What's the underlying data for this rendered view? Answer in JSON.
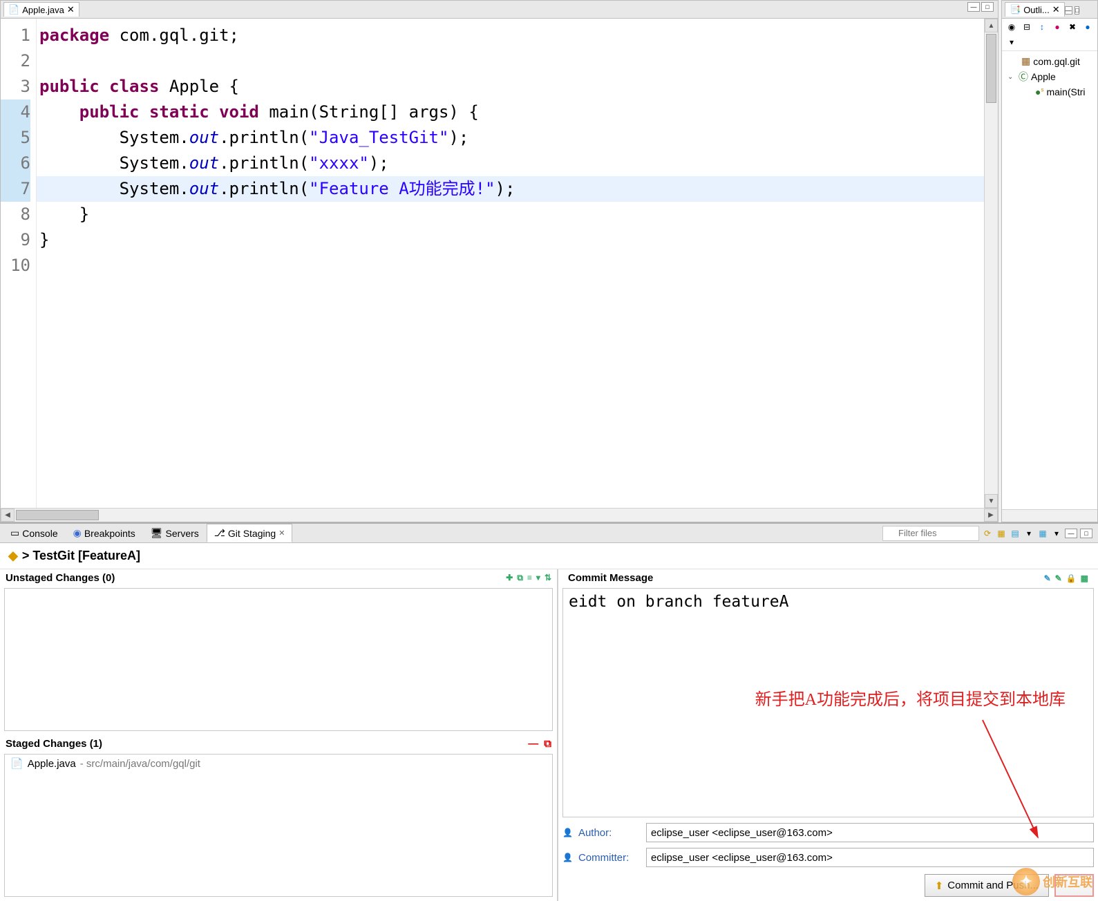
{
  "editor": {
    "tab_title": "Apple.java",
    "lines": [
      {
        "n": 1,
        "html": "<span class='kw'>package</span> com.gql.git;"
      },
      {
        "n": 2,
        "html": ""
      },
      {
        "n": 3,
        "html": "<span class='kw'>public class</span> Apple {"
      },
      {
        "n": 4,
        "html": "    <span class='kw'>public static void</span> main(String[] args) {"
      },
      {
        "n": 5,
        "html": "        System.<span class='field'>out</span>.println(<span class='str'>\"Java_TestGit\"</span>);"
      },
      {
        "n": 6,
        "html": "        System.<span class='field'>out</span>.println(<span class='str'>\"xxxx\"</span>);"
      },
      {
        "n": 7,
        "html": "        System.<span class='field'>out</span>.println(<span class='str'>\"Feature A功能完成!\"</span>);"
      },
      {
        "n": 8,
        "html": "    }"
      },
      {
        "n": 9,
        "html": "}"
      },
      {
        "n": 10,
        "html": ""
      }
    ],
    "highlight_line": 7
  },
  "outline": {
    "tab_title": "Outli...",
    "items": {
      "package": "com.gql.git",
      "class": "Apple",
      "method": "main(Stri"
    }
  },
  "bottom_tabs": {
    "console": "Console",
    "breakpoints": "Breakpoints",
    "servers": "Servers",
    "git_staging": "Git Staging"
  },
  "filter_placeholder": "Filter files",
  "staging": {
    "repo_header": "> TestGit [FeatureA]",
    "unstaged_label": "Unstaged Changes (0)",
    "staged_label": "Staged Changes (1)",
    "staged_file_name": "Apple.java",
    "staged_file_path": " - src/main/java/com/gql/git",
    "commit_message_label": "Commit Message",
    "commit_message_text": "eidt on branch featureA",
    "author_label": "Author:",
    "committer_label": "Committer:",
    "author_value": "eclipse_user <eclipse_user@163.com>",
    "committer_value": "eclipse_user <eclipse_user@163.com>",
    "commit_push_btn": "Commit and Push...",
    "annotation_text": "新手把A功能完成后，将项目提交到本地库"
  },
  "watermark": "创新互联"
}
